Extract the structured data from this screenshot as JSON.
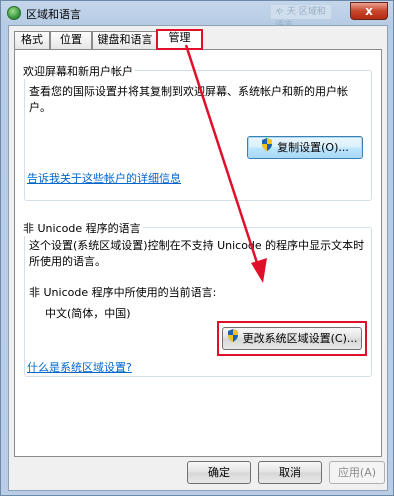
{
  "window": {
    "title": "区域和语言",
    "background_tab_text": "ゃ 天 区域和语言",
    "close_glyph": "x",
    "close_button_color": "#c7452b"
  },
  "tabs": [
    {
      "label": "格式",
      "active": false
    },
    {
      "label": "位置",
      "active": false
    },
    {
      "label": "键盘和语言",
      "active": false
    },
    {
      "label": "管理",
      "active": true
    }
  ],
  "welcome_group": {
    "title": "欢迎屏幕和新用户帐户",
    "description": "查看您的国际设置并将其复制到欢迎屏幕、系统帐户和新的用户帐户。",
    "copy_button": "复制设置(O)...",
    "link": "告诉我关于这些帐户的详细信息"
  },
  "unicode_group": {
    "title": "非 Unicode 程序的语言",
    "description": "这个设置(系统区域设置)控制在不支持 Unicode 的程序中显示文本时所使用的语言。",
    "current_label": "非 Unicode 程序中所使用的当前语言:",
    "current_value": "中文(简体，中国)",
    "change_button": "更改系统区域设置(C)...",
    "link": "什么是系统区域设置?"
  },
  "footer": {
    "ok": "确定",
    "cancel": "取消",
    "apply": "应用(A)"
  },
  "colors": {
    "annotation_red": "#e0102a",
    "link_blue": "#0066cc"
  },
  "icons": [
    "region-globe-icon",
    "uac-shield-icon"
  ]
}
